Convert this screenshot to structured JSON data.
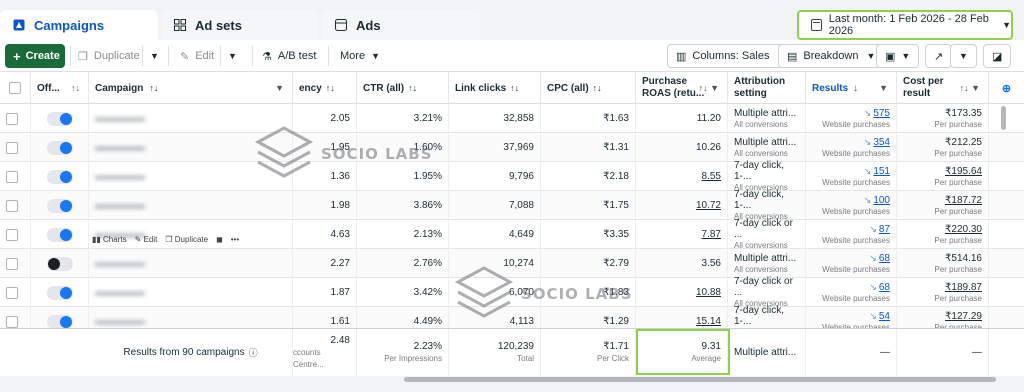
{
  "tabs": [
    {
      "label": "Campaigns",
      "icon": "flag-icon"
    },
    {
      "label": "Ad sets",
      "icon": "grid-icon"
    },
    {
      "label": "Ads",
      "icon": "ad-icon"
    }
  ],
  "date_range": "Last month: 1 Feb 2026 - 28 Feb 2026",
  "toolbar": {
    "create": "Create",
    "duplicate": "Duplicate",
    "edit": "Edit",
    "ab_test": "A/B test",
    "more": "More",
    "columns": "Columns: Sales",
    "breakdown": "Breakdown"
  },
  "headers": {
    "off_on": "Off...",
    "campaign": "Campaign",
    "frequency": "ency",
    "ctr": "CTR (all)",
    "link_clicks": "Link clicks",
    "cpc": "CPC (all)",
    "roas_1": "Purchase",
    "roas_2": "ROAS (retu...",
    "attribution_1": "Attribution",
    "attribution_2": "setting",
    "results": "Results",
    "cost_1": "Cost per",
    "cost_2": "result"
  },
  "rows": [
    {
      "on": true,
      "freq": "2.05",
      "ctr": "3.21%",
      "clicks": "32,858",
      "cpc": "₹1.63",
      "roas": "11.20",
      "attr": "Multiple attri...",
      "attr_sub": "All conversions",
      "results": "575",
      "results_sub": "Website purchases",
      "cost": "₹173.35",
      "cost_sub": "Per purchase"
    },
    {
      "on": true,
      "freq": "1.95",
      "ctr": "1.60%",
      "clicks": "37,969",
      "cpc": "₹1.31",
      "roas": "10.26",
      "attr": "Multiple attri...",
      "attr_sub": "All conversions",
      "results": "354",
      "results_sub": "Website purchases",
      "cost": "₹212.25",
      "cost_sub": "Per purchase"
    },
    {
      "on": true,
      "freq": "1.36",
      "ctr": "1.95%",
      "clicks": "9,796",
      "cpc": "₹2.18",
      "roas": "8.55",
      "attr": "7-day click, 1-...",
      "attr_sub": "All conversions",
      "results": "151",
      "results_sub": "Website purchases",
      "cost": "₹195.64",
      "cost_sub": "Per purchase"
    },
    {
      "on": true,
      "freq": "1.98",
      "ctr": "3.86%",
      "clicks": "7,088",
      "cpc": "₹1.75",
      "roas": "10.72",
      "attr": "7-day click, 1-...",
      "attr_sub": "All conversions",
      "results": "100",
      "results_sub": "Website purchases",
      "cost": "₹187.72",
      "cost_sub": "Per purchase"
    },
    {
      "on": true,
      "freq": "4.63",
      "ctr": "2.13%",
      "clicks": "4,649",
      "cpc": "₹3.35",
      "roas": "7.87",
      "attr": "7-day click or ...",
      "attr_sub": "All conversions",
      "results": "87",
      "results_sub": "Website purchases",
      "cost": "₹220.30",
      "cost_sub": "Per purchase"
    },
    {
      "on": false,
      "freq": "2.27",
      "ctr": "2.76%",
      "clicks": "10,274",
      "cpc": "₹2.79",
      "roas": "3.56",
      "attr": "Multiple attri...",
      "attr_sub": "All conversions",
      "results": "68",
      "results_sub": "Website purchases",
      "cost": "₹514.16",
      "cost_sub": "Per purchase"
    },
    {
      "on": true,
      "freq": "1.87",
      "ctr": "3.42%",
      "clicks": "6,070",
      "cpc": "₹1.83",
      "roas": "10.88",
      "attr": "7-day click or ...",
      "attr_sub": "All conversions",
      "results": "68",
      "results_sub": "Website purchases",
      "cost": "₹189.87",
      "cost_sub": "Per purchase"
    },
    {
      "on": true,
      "freq": "1.61",
      "ctr": "4.49%",
      "clicks": "4,113",
      "cpc": "₹1.29",
      "roas": "15.14",
      "attr": "7-day click, 1-...",
      "attr_sub": "All conversions",
      "results": "54",
      "results_sub": "Website purchases",
      "cost": "₹127.29",
      "cost_sub": "Per purchase"
    }
  ],
  "row_hover_actions": [
    "Charts",
    "Edit",
    "Duplicate"
  ],
  "footer": {
    "label": "Results from 90 campaigns",
    "freq": "2.48",
    "freq_sub": "ccounts Centre...",
    "ctr": "2.23%",
    "ctr_sub": "Per Impressions",
    "clicks": "120,239",
    "clicks_sub": "Total",
    "cpc": "₹1.71",
    "cpc_sub": "Per Click",
    "roas": "9.31",
    "roas_sub": "Average",
    "attr": "Multiple attri...",
    "results": "—",
    "cost": "—"
  },
  "watermark": "SOCIO LABS",
  "colors": {
    "accent": "#0a58ca",
    "highlight": "#8fd14f",
    "create_bg": "#1b6b3a",
    "toggle_on": "#1877f2"
  }
}
